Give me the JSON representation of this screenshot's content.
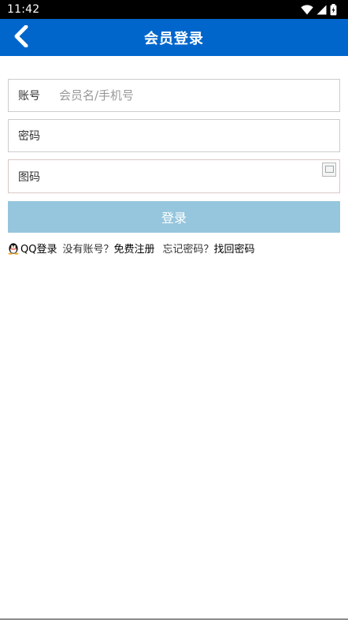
{
  "status_bar": {
    "time": "11:42",
    "icons": [
      "wifi-icon",
      "signal-icon",
      "battery-icon"
    ]
  },
  "app_bar": {
    "title": "会员登录",
    "back_icon": "chevron-left-icon",
    "background_color": "#0066cc"
  },
  "form": {
    "account": {
      "label": "账号",
      "placeholder": "会员名/手机号",
      "value": ""
    },
    "password": {
      "label": "密码",
      "placeholder": "",
      "value": ""
    },
    "captcha": {
      "label": "图码",
      "placeholder": "",
      "value": "",
      "image_icon": "broken-image-icon"
    }
  },
  "login_button": {
    "label": "登录",
    "background_color": "#95c6dd"
  },
  "links": {
    "qq_icon": "qq-penguin-icon",
    "qq_login": "QQ登录",
    "no_account_prompt": "没有账号？",
    "register": "免费注册",
    "forgot_prompt": "忘记密码？",
    "recover": "找回密码"
  }
}
